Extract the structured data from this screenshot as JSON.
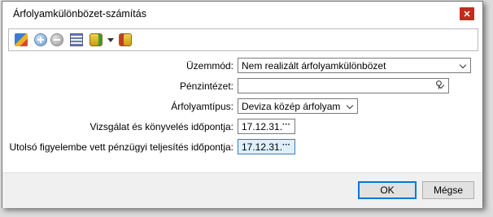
{
  "window": {
    "title": "Árfolyamkülönbözet-számítás",
    "close_symbol": "✕"
  },
  "toolbar": {
    "icons": [
      "edit-icon",
      "add-icon",
      "remove-icon",
      "calculator-icon",
      "coins-icon",
      "dropdown-arrow-icon",
      "export-icon"
    ]
  },
  "form": {
    "mode_label": "Üzemmód:",
    "mode_value": "Nem realizált árfolyamkülönbözet",
    "bank_label": "Pénzintézet:",
    "bank_value": "",
    "rate_type_label": "Árfolyamtípus:",
    "rate_type_value": "Deviza közép árfolyam",
    "audit_date_label": "Vizsgálat és könyvelés időpontja:",
    "audit_date_value": "17.12.31.",
    "last_fin_date_label": "Utolsó figyelembe vett pénzügyi teljesítés időpontja:",
    "last_fin_date_value": "17.12.31.",
    "ellipsis": "···",
    "attach_symbol": "⚲"
  },
  "footer": {
    "ok_label": "OK",
    "cancel_label": "Mégse"
  },
  "colors": {
    "close_button": "#c42b1c",
    "focused_field": "#dcefff",
    "primary_border": "#0078d7",
    "footer_bg": "#f0f0f0"
  }
}
